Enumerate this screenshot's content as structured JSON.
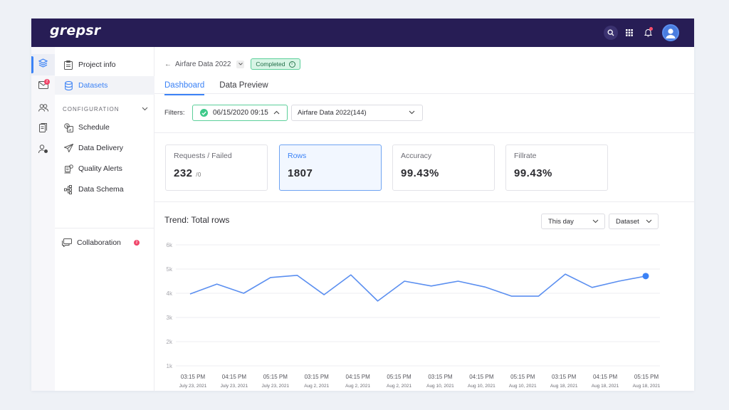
{
  "app": {
    "logo": "grepsr",
    "topbar_icons": [
      "search-icon",
      "apps-grid-icon",
      "notification-bell-icon",
      "user-avatar-icon"
    ]
  },
  "rail": {
    "items": [
      {
        "icon": "layers-icon",
        "active": true
      },
      {
        "icon": "mail-icon",
        "badge": "2"
      },
      {
        "icon": "users-icon"
      },
      {
        "icon": "document-icon"
      },
      {
        "icon": "user-settings-icon"
      }
    ]
  },
  "sidebar": {
    "items": [
      {
        "label": "Project info",
        "icon": "project-info-icon"
      },
      {
        "label": "Datasets",
        "icon": "database-icon",
        "active": true
      }
    ],
    "section_label": "CONFIGURATION",
    "config_items": [
      {
        "label": "Schedule",
        "icon": "schedule-icon"
      },
      {
        "label": "Data Delivery",
        "icon": "send-icon"
      },
      {
        "label": "Quality Alerts",
        "icon": "quality-alert-icon"
      },
      {
        "label": "Data Schema",
        "icon": "schema-icon"
      }
    ],
    "collaboration": {
      "label": "Collaboration",
      "badge": "2"
    }
  },
  "header": {
    "back_arrow": "←",
    "title": "Airfare Data 2022",
    "status": "Completed",
    "tabs": [
      {
        "label": "Dashboard",
        "active": true
      },
      {
        "label": "Data Preview"
      }
    ]
  },
  "filters": {
    "label": "Filters:",
    "date_value": "06/15/2020 09:15",
    "dataset_value": "Airfare Data 2022(144)"
  },
  "cards": [
    {
      "label": "Requests / Failed",
      "value": "232",
      "sub": "/0"
    },
    {
      "label": "Rows",
      "value": "1807",
      "active": true
    },
    {
      "label": "Accuracy",
      "value": "99.43%"
    },
    {
      "label": "Fillrate",
      "value": "99.43%"
    }
  ],
  "trend": {
    "title": "Trend: Total rows",
    "period_select": "This day",
    "group_select": "Dataset"
  },
  "chart_data": {
    "type": "line",
    "title": "Trend: Total rows",
    "xlabel": "",
    "ylabel": "",
    "ylim": [
      1000,
      6000
    ],
    "yticks": [
      "1k",
      "2k",
      "3k",
      "4k",
      "5k",
      "6k"
    ],
    "ytick_values": [
      1000,
      2000,
      3000,
      4000,
      5000,
      6000
    ],
    "grid": true,
    "x_tick_labels": [
      {
        "time": "03:15 PM",
        "date": "July 23, 2021"
      },
      {
        "time": "04:15 PM",
        "date": "July 23, 2021"
      },
      {
        "time": "05:15 PM",
        "date": "July 23, 2021"
      },
      {
        "time": "03:15 PM",
        "date": "Aug 2, 2021"
      },
      {
        "time": "04:15 PM",
        "date": "Aug 2, 2021"
      },
      {
        "time": "05:15 PM",
        "date": "Aug 2, 2021"
      },
      {
        "time": "03:15 PM",
        "date": "Aug 10, 2021"
      },
      {
        "time": "04:15 PM",
        "date": "Aug 10, 2021"
      },
      {
        "time": "05:15 PM",
        "date": "Aug 10, 2021"
      },
      {
        "time": "03:15 PM",
        "date": "Aug 18, 2021"
      },
      {
        "time": "04:15 PM",
        "date": "Aug 18, 2021"
      },
      {
        "time": "05:15 PM",
        "date": "Aug 18, 2021"
      }
    ],
    "series": [
      {
        "name": "Total rows",
        "color": "#5b8ff0",
        "values": [
          3970,
          4380,
          4000,
          4650,
          4740,
          3940,
          4760,
          3680,
          4500,
          4300,
          4500,
          4260,
          3880,
          3880,
          4790,
          4240,
          4500,
          4710
        ],
        "highlight_last": true
      }
    ]
  },
  "colors": {
    "topbar": "#271d55",
    "accent": "#3b82f6",
    "success": "#3ec98a",
    "badge": "#f0466a"
  }
}
